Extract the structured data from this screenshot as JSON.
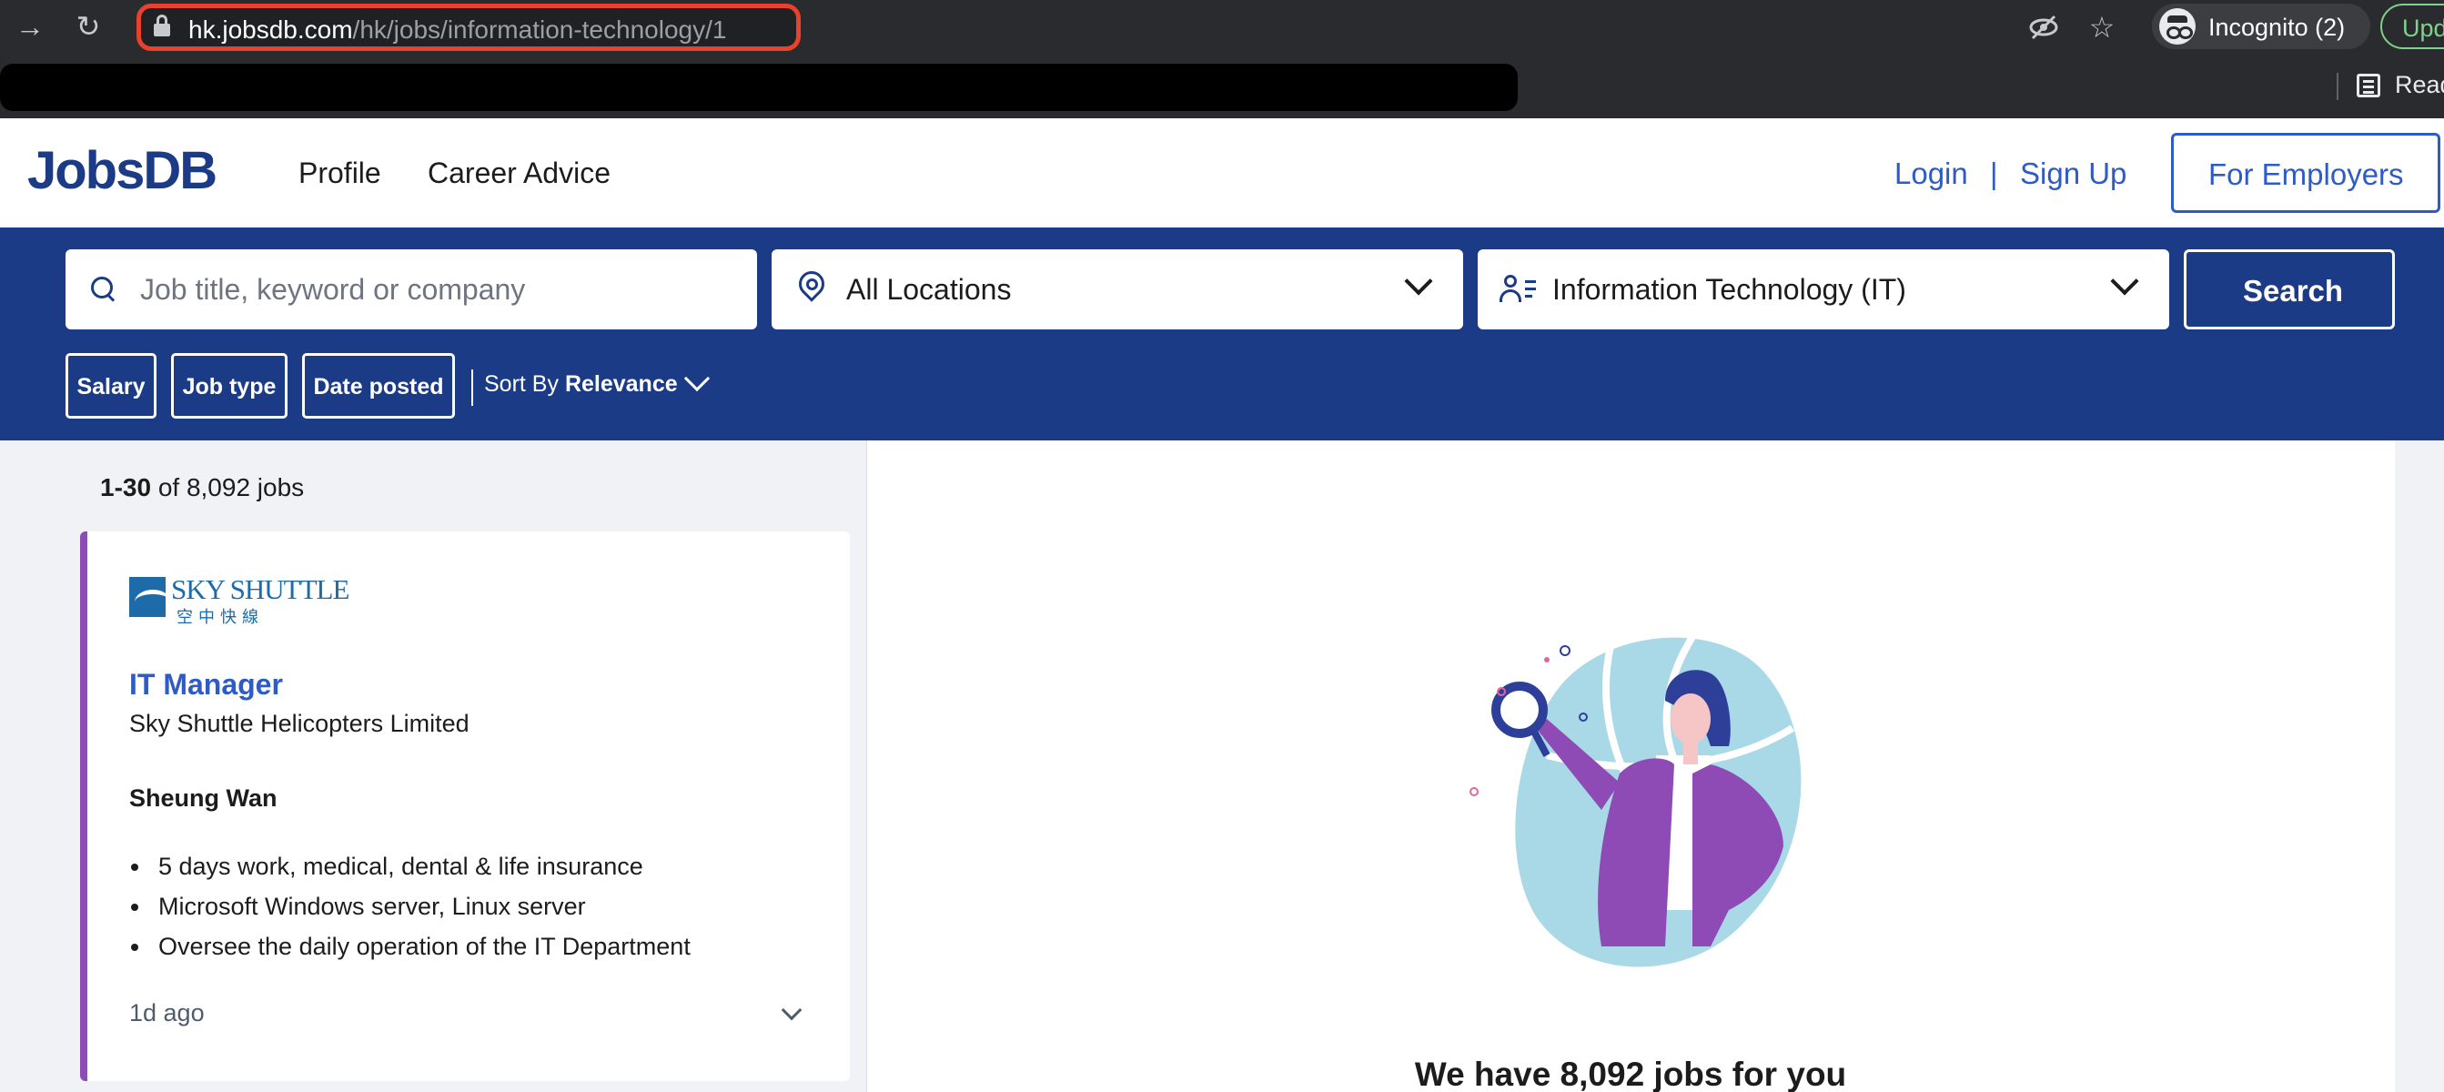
{
  "browser": {
    "url_host": "hk.jobsdb.com",
    "url_path": "/hk/jobs/information-technology/1",
    "profile_label": "Incognito (2)",
    "update_label": "Upd",
    "reading_list_label": "Read"
  },
  "header": {
    "logo": "JobsDB",
    "nav": [
      "Profile",
      "Career Advice"
    ],
    "login": "Login",
    "separator": "|",
    "signup": "Sign Up",
    "employers": "For Employers"
  },
  "search": {
    "keyword_placeholder": "Job title, keyword or company",
    "location_value": "All Locations",
    "classification_value": "Information Technology (IT)",
    "search_button": "Search",
    "filters": [
      "Salary",
      "Job type",
      "Date posted"
    ],
    "sort_prefix": "Sort By",
    "sort_value": "Relevance"
  },
  "results": {
    "range": "1-30",
    "of_text": "of 8,092 jobs"
  },
  "job": {
    "logo_text": "SKY SHUTTLE",
    "logo_cn": "空中快線",
    "title": "IT Manager",
    "company": "Sky Shuttle Helicopters Limited",
    "location": "Sheung Wan",
    "bullets": [
      "5 days work, medical, dental & life insurance",
      "Microsoft Windows server, Linux server",
      "Oversee the daily operation of the IT Department"
    ],
    "posted": "1d ago"
  },
  "detail": {
    "heading": "We have 8,092 jobs for you"
  },
  "colors": {
    "brand_navy": "#1c3b87",
    "link_blue": "#2e5bc5",
    "card_accent": "#8e4bb5",
    "omnibox_highlight": "#e8412c"
  }
}
